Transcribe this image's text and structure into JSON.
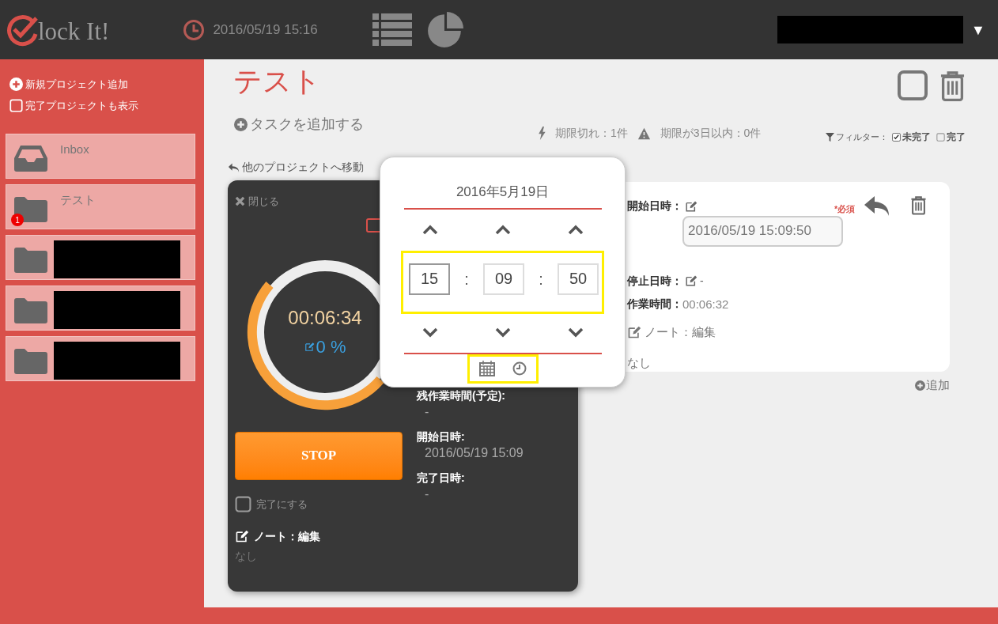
{
  "header": {
    "logo_text": "lock It!",
    "clock": "2016/05/19 15:16",
    "account_redacted": true,
    "account_caret": "▼"
  },
  "sidebar": {
    "actions": [
      {
        "kind": "add",
        "label": "新規プロジェクト追加"
      },
      {
        "kind": "checkbox",
        "label": "完了プロジェクトも表示",
        "checked": false
      }
    ],
    "projects": [
      {
        "kind": "inbox",
        "label": "Inbox"
      },
      {
        "kind": "folder",
        "label": "テスト",
        "badge": "1"
      },
      {
        "kind": "folder",
        "redacted": true
      },
      {
        "kind": "folder",
        "redacted": true
      },
      {
        "kind": "folder",
        "redacted": true
      }
    ]
  },
  "main": {
    "title": "テスト",
    "select_all": {
      "checked": false
    },
    "add_task": "タスクを追加する",
    "alerts": [
      {
        "kind": "bolt",
        "text": "期限切れ：1件"
      },
      {
        "kind": "warning",
        "text": "期限が3日以内：0件"
      }
    ],
    "filter": {
      "label": "フィルター：",
      "options": [
        {
          "label": "未完了",
          "checked": true
        },
        {
          "label": "完了",
          "checked": false
        }
      ]
    },
    "move_link": "他のプロジェクトへ移動"
  },
  "timer_card": {
    "close": "閉じる",
    "time": "00:06:34",
    "percent": "0 %",
    "stop": "STOP",
    "complete": {
      "label": "完了にする",
      "checked": false
    },
    "note_label": "ノート：編集",
    "note": "なし",
    "details": [
      {
        "label": "残作業時間(予定):",
        "value": "-"
      },
      {
        "label": "開始日時:",
        "value": "2016/05/19 15:09"
      },
      {
        "label": "完了日時:",
        "value": "-"
      }
    ]
  },
  "log_card": {
    "start_label": "開始日時：",
    "start_value": "2016/05/19 15:09:50",
    "required": "*必須",
    "stop_label": "停止日時：",
    "stop_value": "-",
    "work_label": "作業時間：",
    "work_value": "00:06:32",
    "note_label": "ノート：編集",
    "note": "なし",
    "add": "追加"
  },
  "picker": {
    "date": "2016年5月19日",
    "fields": [
      "15",
      "09",
      "50"
    ],
    "separator": ":"
  }
}
